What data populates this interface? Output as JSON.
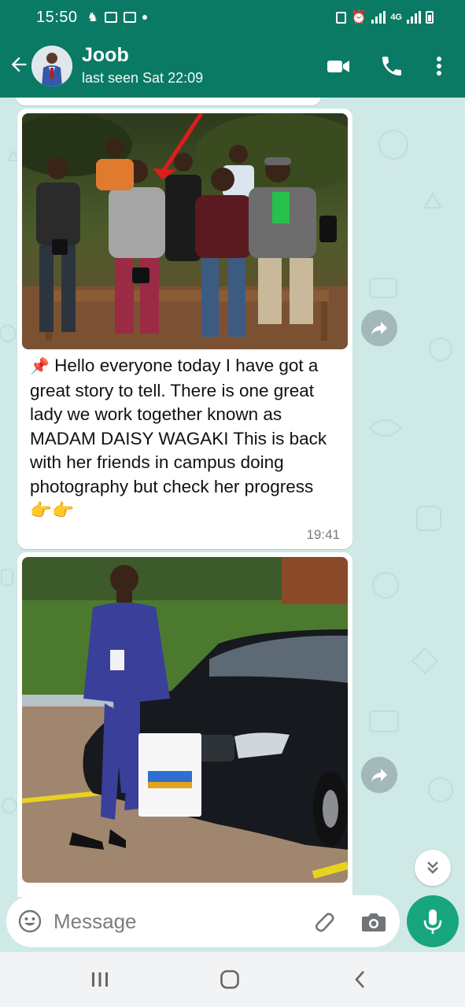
{
  "status_bar": {
    "time": "15:50",
    "network_label": "4G"
  },
  "header": {
    "contact_name": "Joob",
    "last_seen": "last seen Sat 22:09",
    "icons": [
      "back-arrow-icon",
      "video-call-icon",
      "voice-call-icon",
      "more-vert-icon"
    ]
  },
  "chat": {
    "messages": [
      {
        "type": "image_caption",
        "image_desc_icon": "photo",
        "caption_emoji_prefix": "📌",
        "caption": "Hello everyone today I have got a great story to tell. There is one great lady we work together known as MADAM DAISY WAGAKI This is back with her friends in campus doing photography but check her progress",
        "caption_emoji_suffix": "👉👉",
        "time": "19:41"
      },
      {
        "type": "image",
        "time": ""
      }
    ]
  },
  "composer": {
    "placeholder": "Message"
  },
  "colors": {
    "header": "#0a7a64",
    "accent": "#17a67d",
    "wallpaper": "#cfe9e6",
    "bubble": "#ffffff"
  }
}
